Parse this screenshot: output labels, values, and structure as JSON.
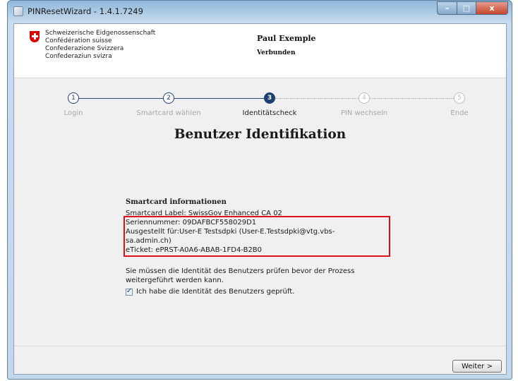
{
  "window": {
    "title": "PINResetWizard - 1.4.1.7249",
    "minimize": "–",
    "maximize": "□",
    "close": "x"
  },
  "header": {
    "confederation": [
      "Schweizerische Eidgenossenschaft",
      "Confédération suisse",
      "Confederazione Svizzera",
      "Confederaziun svizra"
    ],
    "user_name": "Paul Exemple",
    "status": "Verbunden"
  },
  "steps": [
    {
      "number": "1",
      "label": "Login",
      "state": "done"
    },
    {
      "number": "2",
      "label": "Smartcard wählen",
      "state": "done"
    },
    {
      "number": "3",
      "label": "Identitätscheck",
      "state": "current"
    },
    {
      "number": "4",
      "label": "PIN wechseln",
      "state": "future"
    },
    {
      "number": "5",
      "label": "Ende",
      "state": "future"
    }
  ],
  "page_title": "Benutzer Identifikation",
  "smartcard": {
    "heading": "Smartcard informationen",
    "label_line": "Smartcard Label: SwissGov Enhanced CA 02",
    "serial_line": "Seriennummer: 09DAFBCF558029D1",
    "issued_line1": "Ausgestellt für:User-E Testsdpki (User-E.Testsdpki@vtg.vbs-",
    "issued_line2": "sa.admin.ch)",
    "eticket_line": "eTicket: ePRST-A0A6-ABAB-1FD4-B2B0"
  },
  "notice": {
    "line1": "Sie müssen die Identität des Benutzers prüfen bevor der Prozess",
    "line2": "weitergeführt werden kann."
  },
  "confirm_label": "Ich habe die Identität des Benutzers geprüft.",
  "confirm_checked": true,
  "next_button": "Weiter >",
  "colors": {
    "accent": "#1f3f70",
    "highlight_box": "#e0101a",
    "swiss_red": "#dc0000"
  }
}
